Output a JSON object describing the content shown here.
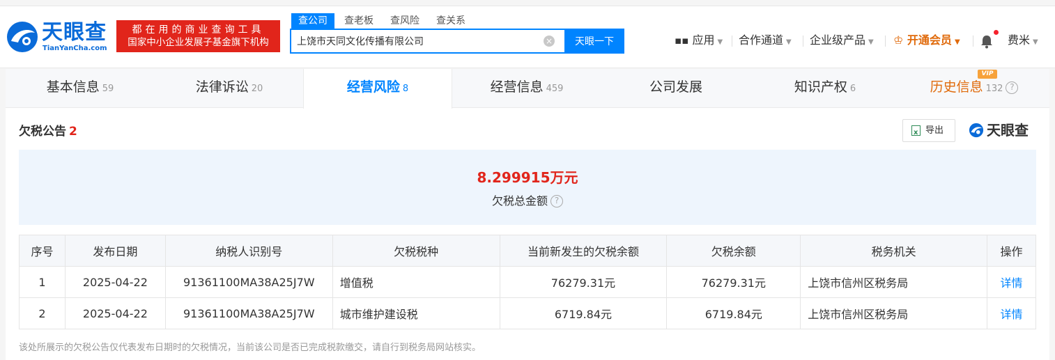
{
  "header": {
    "logo_cn": "天眼查",
    "logo_en": "TianYanCha.com",
    "slogan_line1": "都在用的商业查询工具",
    "slogan_line2": "国家中小企业发展子基金旗下机构",
    "search_tabs": [
      "查公司",
      "查老板",
      "查风险",
      "查关系"
    ],
    "search_value": "上饶市天同文化传播有限公司",
    "search_button": "天眼一下",
    "nav": {
      "apps": "应用",
      "cooperation": "合作通道",
      "enterprise": "企业级产品",
      "vip": "开通会员",
      "user": "费米"
    }
  },
  "tabs": [
    {
      "label": "基本信息",
      "count": "59"
    },
    {
      "label": "法律诉讼",
      "count": "20"
    },
    {
      "label": "经营风险",
      "count": "8"
    },
    {
      "label": "经营信息",
      "count": "459"
    },
    {
      "label": "公司发展",
      "count": ""
    },
    {
      "label": "知识产权",
      "count": "6"
    },
    {
      "label": "历史信息",
      "count": "132"
    }
  ],
  "vip_badge": "VIP",
  "section": {
    "title": "欠税公告",
    "count": "2",
    "export_label": "导出",
    "brand": "天眼查"
  },
  "summary": {
    "amount": "8.299915万元",
    "label": "欠税总金额"
  },
  "table": {
    "headers": [
      "序号",
      "发布日期",
      "纳税人识别号",
      "欠税税种",
      "当前新发生的欠税余额",
      "欠税余额",
      "税务机关",
      "操作"
    ],
    "rows": [
      [
        "1",
        "2025-04-22",
        "91361100MA38A25J7W",
        "增值税",
        "76279.31元",
        "76279.31元",
        "上饶市信州区税务局",
        "详情"
      ],
      [
        "2",
        "2025-04-22",
        "91361100MA38A25J7W",
        "城市维护建设税",
        "6719.84元",
        "6719.84元",
        "上饶市信州区税务局",
        "详情"
      ]
    ]
  },
  "footnote": "该处所展示的欠税公告仅代表发布日期时的欠税情况，当前该公司是否已完成税款缴交，请自行到税务局网站核实。",
  "colors": {
    "accent": "#0084ff",
    "brand_red": "#e1251b",
    "vip_orange": "#e06a0b"
  }
}
